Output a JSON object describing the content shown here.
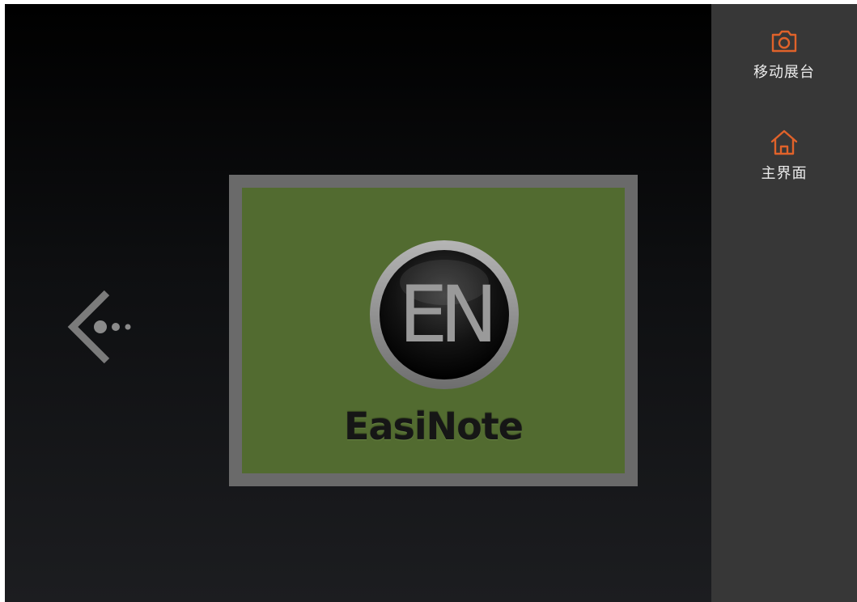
{
  "sidebar": {
    "buttons": [
      {
        "id": "mobile-presenter",
        "label": "移动展台",
        "icon": "camera-icon"
      },
      {
        "id": "home",
        "label": "主界面",
        "icon": "home-icon"
      }
    ]
  },
  "main": {
    "back_icon": "back-arrow-icon",
    "app_card": {
      "logo_text": "EN",
      "app_name": "EasiNote"
    }
  },
  "colors": {
    "accent": "#e0622a",
    "sidebar_bg": "#373737",
    "card_frame": "#6a6a6a",
    "card_bg": "#526b30"
  }
}
